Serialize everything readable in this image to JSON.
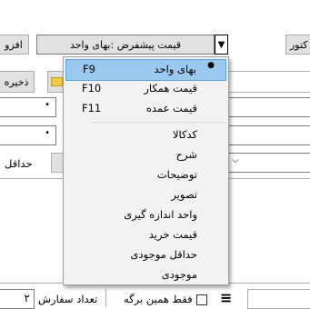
{
  "toolbar": {
    "left_button_label": "افزو",
    "right_button_label": "کتور",
    "save_button_label": "ذخیره",
    "price_combo_value": "قیمت پیشفرض :بهای واحد"
  },
  "form": {
    "field1_marker": "•",
    "field2_marker": "•",
    "min_label": "حداقل",
    "only_same_sheet_label": "فقط همین برگه",
    "order_count_label": "تعداد سفارش",
    "order_count_value": "۲"
  },
  "menu": {
    "items": [
      {
        "label": "بهای واحد",
        "shortcut": "F9",
        "selected": true
      },
      {
        "label": "قیمت همکار",
        "shortcut": "F10"
      },
      {
        "label": "قیمت عمده",
        "shortcut": "F11"
      },
      {
        "label": "کدکالا"
      },
      {
        "label": "شرح"
      },
      {
        "label": "توضیحات"
      },
      {
        "label": "تصویر"
      },
      {
        "label": "واحد اندازه گیری"
      },
      {
        "label": "قیمت خرید"
      },
      {
        "label": "حداقل موجودی"
      },
      {
        "label": "موجودی"
      }
    ],
    "checkmark": "●"
  },
  "icons": {
    "dropdown_arrow": "▼",
    "list_icon": "≡"
  },
  "colors": {
    "selection_bg": "#99c9ef",
    "menu_bg": "#f2f2f2"
  }
}
